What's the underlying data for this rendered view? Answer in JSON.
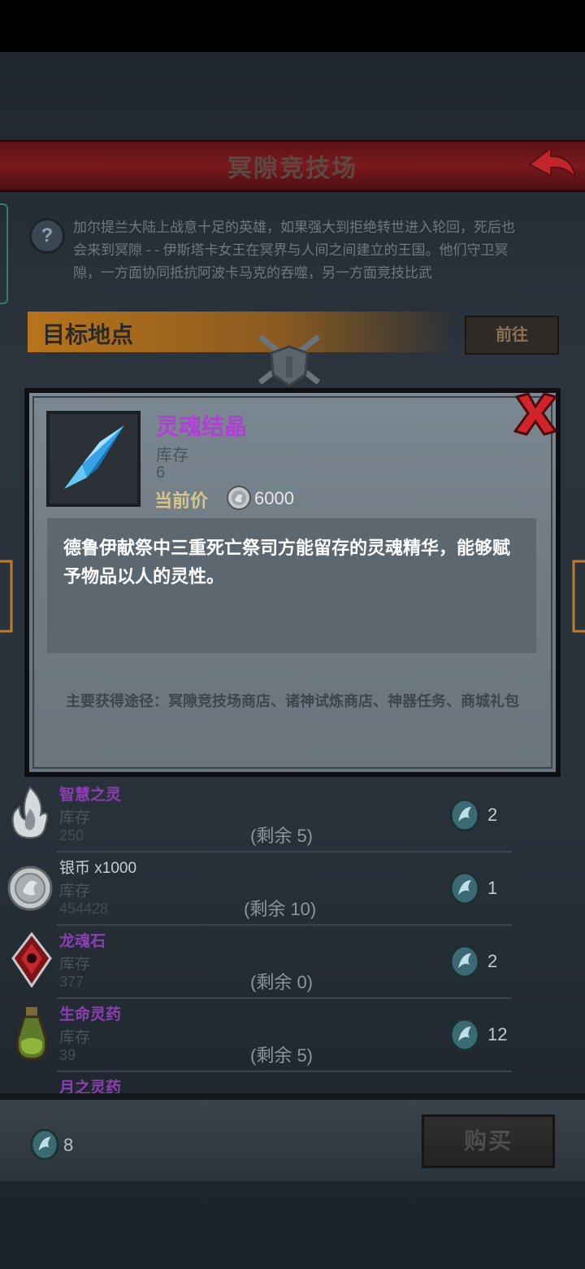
{
  "header": {
    "title": "冥隙竞技场"
  },
  "info": {
    "text": "加尔提兰大陆上战意十足的英雄，如果强大到拒绝转世进入轮回，死后也会来到冥隙 - - 伊斯塔卡女王在冥界与人间之间建立的王国。他们守卫冥隙，一方面协同抵抗阿波卡马克的吞噬，另一方面竞技比武"
  },
  "target": {
    "label": "目标地点",
    "goto_label": "前往"
  },
  "modal": {
    "item_name": "灵魂结晶",
    "stock_label": "库存",
    "stock_value": "6",
    "price_label": "当前价",
    "price_value": "6000",
    "description": "德鲁伊献祭中三重死亡祭司方能留存的灵魂精华，能够赋予物品以人的灵性。",
    "source": "主要获得途径：冥隙竞技场商店、诸神试炼商店、神器任务、商城礼包"
  },
  "shop_items": [
    {
      "name": "智慧之灵",
      "stock_label": "库存",
      "stock": "250",
      "remain": "(剩余 5)",
      "price": "2",
      "icon": "flame-icon"
    },
    {
      "name": "银币",
      "suffix": " x1000",
      "stock_label": "库存",
      "stock": "454428",
      "remain": "(剩余 10)",
      "price": "1",
      "icon": "silver-coin-icon"
    },
    {
      "name": "龙魂石",
      "stock_label": "库存",
      "stock": "377",
      "remain": "(剩余 0)",
      "price": "2",
      "icon": "dragon-gem-icon"
    },
    {
      "name": "生命灵药",
      "stock_label": "库存",
      "stock": "39",
      "remain": "(剩余 5)",
      "price": "12",
      "icon": "potion-icon"
    },
    {
      "name": "月之灵药"
    }
  ],
  "footer": {
    "currency_count": "8",
    "buy_label": "购买"
  },
  "colors": {
    "header_red": "#7a1a1e",
    "item_purple": "#b33dd8",
    "target_orange": "#b7741a"
  }
}
